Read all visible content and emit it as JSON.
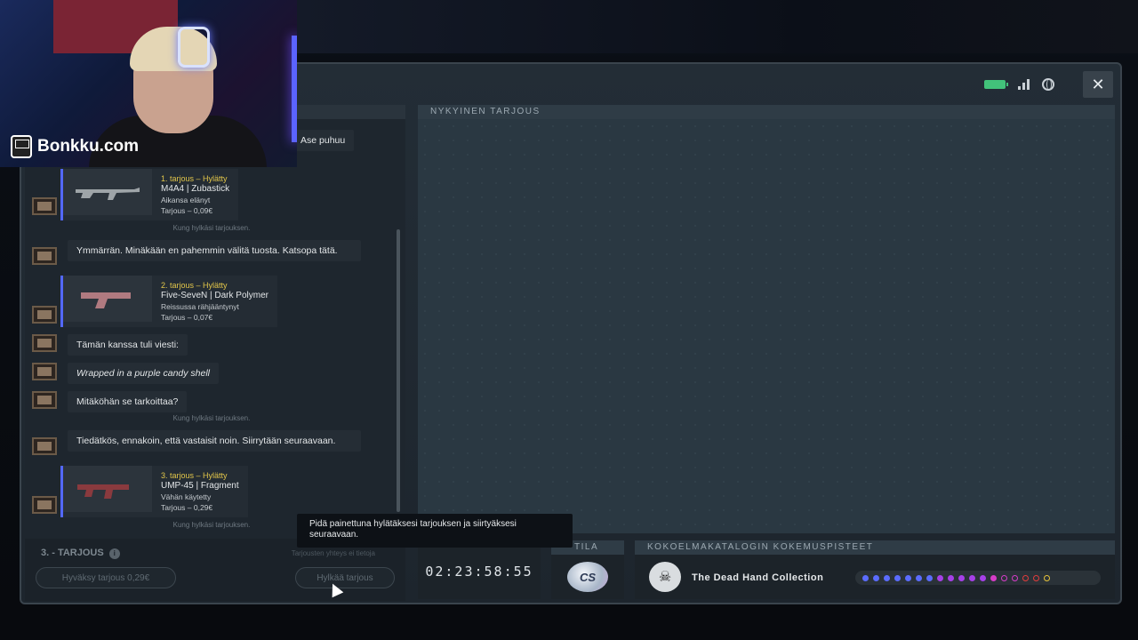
{
  "branding": {
    "watermark": "Bonkku.com"
  },
  "window": {
    "close_symbol": "✕",
    "status_icons": [
      "battery-icon",
      "signal-icon",
      "globe-icon"
    ]
  },
  "chat": {
    "partial_message": "Ase puhuu",
    "offer1": {
      "status": "1. tarjous – Hylätty",
      "name": "M4A4 | Zubastick",
      "condition": "Aikansa elänyt",
      "price": "Tarjous – 0,09€"
    },
    "note1": "Kung hylkäsi tarjouksen.",
    "msg_ymmarran": "Ymmärrän. Minäkään en pahemmin välitä tuosta. Katsopa tätä.",
    "offer2": {
      "status": "2. tarjous – Hylätty",
      "name": "Five-SeveN | Dark Polymer",
      "condition": "Reissussa rähjääntynyt",
      "price": "Tarjous – 0,07€"
    },
    "msg_viesti": "Tämän kanssa tuli viesti:",
    "msg_candy": "Wrapped in a purple candy shell",
    "msg_tarkoittaa": "Mitäköhän se tarkoittaa?",
    "note2": "Kung hylkäsi tarjouksen.",
    "msg_tiedatkos": "Tiedätkös, ennakoin, että vastaisit noin. Siirrytään seuraavaan.",
    "offer3": {
      "status": "3. tarjous – Hylätty",
      "name": "UMP-45 | Fragment",
      "condition": "Vähän käytetty",
      "price": "Tarjous – 0,29€"
    },
    "note3": "Kung hylkäsi tarjouksen."
  },
  "footer": {
    "offer_count": "3. - TARJOUS",
    "offer_hint": "Tarjousten yhteys ei tietoja",
    "accept_button": "Hyväksy tarjous 0,29€",
    "reject_button": "Hylkää tarjous"
  },
  "tooltip": "Pidä painettuna hylätäksesi tarjouksen ja siirtyäksesi seuraavaan.",
  "current_offer": {
    "title": "NYKYINEN TARJOUS"
  },
  "timer": {
    "value": "02:23:58:55"
  },
  "state": {
    "title": "TILA",
    "logo_text": "CS"
  },
  "xp": {
    "title": "KOKOELMAKATALOGIN KOKEMUSPISTEET",
    "collection_name": "The Dead Hand Collection",
    "dots": [
      {
        "color": "#5b6cff",
        "filled": true
      },
      {
        "color": "#5b6cff",
        "filled": true
      },
      {
        "color": "#5b6cff",
        "filled": true
      },
      {
        "color": "#5b6cff",
        "filled": true
      },
      {
        "color": "#5b6cff",
        "filled": true
      },
      {
        "color": "#5b6cff",
        "filled": true
      },
      {
        "color": "#5b6cff",
        "filled": true
      },
      {
        "color": "#a640e8",
        "filled": true
      },
      {
        "color": "#a640e8",
        "filled": true
      },
      {
        "color": "#a640e8",
        "filled": true
      },
      {
        "color": "#a640e8",
        "filled": true
      },
      {
        "color": "#a640e8",
        "filled": true
      },
      {
        "color": "#d63cc8",
        "filled": true
      },
      {
        "color": "#d63cc8",
        "filled": false
      },
      {
        "color": "#d63cc8",
        "filled": false
      },
      {
        "color": "#e33c3c",
        "filled": false
      },
      {
        "color": "#e33c3c",
        "filled": false
      },
      {
        "color": "#e6c33a",
        "filled": false
      }
    ]
  }
}
